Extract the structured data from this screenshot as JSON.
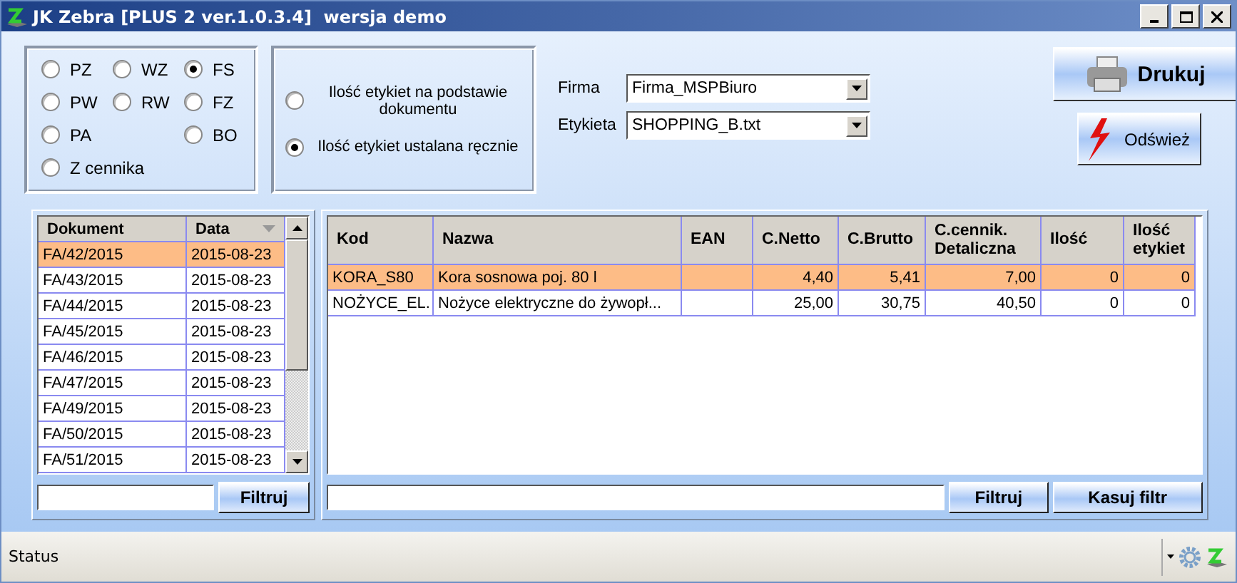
{
  "window": {
    "title": "JK Zebra [PLUS 2 ver.1.0.3.4]  wersja demo"
  },
  "document_types": [
    {
      "label": "PZ",
      "selected": false
    },
    {
      "label": "WZ",
      "selected": false
    },
    {
      "label": "FS",
      "selected": true
    },
    {
      "label": "PW",
      "selected": false
    },
    {
      "label": "RW",
      "selected": false
    },
    {
      "label": "FZ",
      "selected": false
    },
    {
      "label": "PA",
      "selected": false
    },
    {
      "label": "BO",
      "selected": false
    },
    {
      "label": "Z cennika",
      "selected": false
    }
  ],
  "label_count_mode": [
    {
      "label": "Ilość etykiet na podstawie dokumentu",
      "selected": false
    },
    {
      "label": "Ilość etykiet ustalana ręcznie",
      "selected": true
    }
  ],
  "firma": {
    "label": "Firma",
    "value": "Firma_MSPBiuro"
  },
  "etykieta": {
    "label": "Etykieta",
    "value": "SHOPPING_B.txt"
  },
  "print_button": "Drukuj",
  "refresh_button": "Odśwież",
  "documents": {
    "columns": [
      "Dokument",
      "Data"
    ],
    "rows": [
      {
        "cells": [
          "FA/42/2015",
          "2015-08-23"
        ],
        "selected": true
      },
      {
        "cells": [
          "FA/43/2015",
          "2015-08-23"
        ],
        "selected": false
      },
      {
        "cells": [
          "FA/44/2015",
          "2015-08-23"
        ],
        "selected": false
      },
      {
        "cells": [
          "FA/45/2015",
          "2015-08-23"
        ],
        "selected": false
      },
      {
        "cells": [
          "FA/46/2015",
          "2015-08-23"
        ],
        "selected": false
      },
      {
        "cells": [
          "FA/47/2015",
          "2015-08-23"
        ],
        "selected": false
      },
      {
        "cells": [
          "FA/49/2015",
          "2015-08-23"
        ],
        "selected": false
      },
      {
        "cells": [
          "FA/50/2015",
          "2015-08-23"
        ],
        "selected": false
      },
      {
        "cells": [
          "FA/51/2015",
          "2015-08-23"
        ],
        "selected": false
      }
    ],
    "filter_button": "Filtruj"
  },
  "products": {
    "columns": [
      {
        "label": "Kod",
        "kind": "text"
      },
      {
        "label": "Nazwa",
        "kind": "text"
      },
      {
        "label": "EAN",
        "kind": "text"
      },
      {
        "label": "C.Netto",
        "kind": "number"
      },
      {
        "label": "C.Brutto",
        "kind": "number"
      },
      {
        "label": "C.cennik. Detaliczna",
        "kind": "number"
      },
      {
        "label": "Ilość",
        "kind": "number"
      },
      {
        "label": "Ilość etykiet",
        "kind": "number"
      }
    ],
    "rows": [
      {
        "cells": [
          "KORA_S80",
          "Kora sosnowa poj. 80 l",
          "",
          "4,40",
          "5,41",
          "7,00",
          "0",
          "0"
        ],
        "selected": true
      },
      {
        "cells": [
          "NOŻYCE_EL.",
          "Nożyce elektryczne do żywopł...",
          "",
          "25,00",
          "30,75",
          "40,50",
          "0",
          "0"
        ],
        "selected": false
      }
    ],
    "filter_button": "Filtruj",
    "clear_filter_button": "Kasuj filtr"
  },
  "status_bar": {
    "text": "Status"
  }
}
